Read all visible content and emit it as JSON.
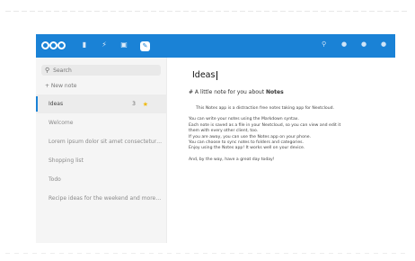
{
  "app": {
    "logo_name": "nextcloud-logo",
    "brand_color": "#1a82d6",
    "app_icons": [
      {
        "name": "files-icon",
        "glyph": "▮"
      },
      {
        "name": "activity-icon",
        "glyph": "⚡"
      },
      {
        "name": "photos-icon",
        "glyph": "▣"
      },
      {
        "name": "notes-icon",
        "glyph": "✎"
      }
    ],
    "header_right_icons": [
      {
        "name": "search-icon",
        "glyph": "⚲"
      },
      {
        "name": "notifications-icon",
        "glyph": "●"
      },
      {
        "name": "contacts-icon",
        "glyph": "●"
      },
      {
        "name": "user-avatar-icon",
        "glyph": "●"
      }
    ]
  },
  "sidebar": {
    "search_placeholder": "Search",
    "new_note_label": "+ New note",
    "notes": [
      {
        "label": "Ideas",
        "count": "3",
        "starred": true,
        "active": true
      },
      {
        "label": "Welcome",
        "count": "",
        "starred": false,
        "active": false
      },
      {
        "label": "Lorem ipsum dolor sit amet consectetur…",
        "count": "",
        "starred": false,
        "active": false
      },
      {
        "label": "Shopping list",
        "count": "",
        "starred": false,
        "active": false
      },
      {
        "label": "Todo",
        "count": "",
        "starred": false,
        "active": false
      },
      {
        "label": "Recipe ideas for the weekend and more…",
        "count": "",
        "starred": false,
        "active": false
      }
    ]
  },
  "editor": {
    "title": "Ideas",
    "heading_prefix": "# A little note for you about",
    "heading_bold": "Notes",
    "lines": [
      "This Notes app is a distraction free notes taking app for Nextcloud.",
      "",
      "You can write your notes using the Markdown syntax.",
      "Each note is saved as a file in your Nextcloud, so you can view and edit it",
      "them with every other client, too.",
      "If you are away, you can use the Notes app on your phone.",
      "You can choose to sync notes to folders and categories.",
      "Enjoy using the Notes app! It works well on your device.",
      "",
      "And, by the way, have a great day today!"
    ]
  }
}
